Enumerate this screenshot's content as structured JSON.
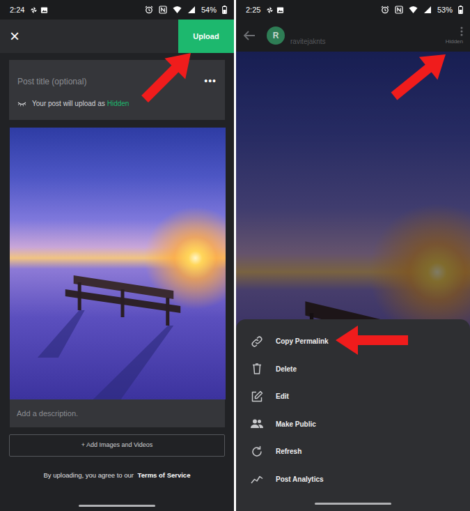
{
  "left": {
    "status_bar": {
      "time": "2:24",
      "battery": "54%"
    },
    "close": "×",
    "upload_button": "Upload",
    "post_title_placeholder": "Post title (optional)",
    "more": "•••",
    "visibility_notice": {
      "text": "Your post will upload as",
      "status": "Hidden"
    },
    "description_placeholder": "Add a description.",
    "add_media_button": "+ Add Images and Videos",
    "terms": {
      "text": "By uploading, you agree to our",
      "link": "Terms of Service"
    }
  },
  "right": {
    "status_bar": {
      "time": "2:25",
      "battery": "53%"
    },
    "avatar": "R",
    "username": "ravitejaknts",
    "visibility": "Hidden",
    "menu": [
      "Copy Permalink",
      "Delete",
      "Edit",
      "Make Public",
      "Refresh",
      "Post Analytics"
    ]
  }
}
